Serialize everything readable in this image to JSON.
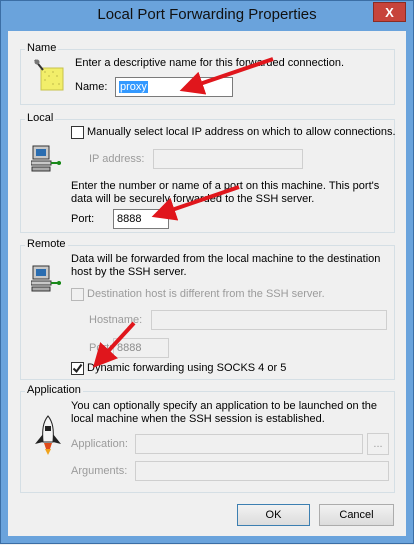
{
  "window": {
    "title": "Local Port Forwarding Properties",
    "close_glyph": "X"
  },
  "name_group": {
    "title": "Name",
    "description": "Enter a descriptive name for this forwarded connection.",
    "name_label": "Name:",
    "name_value": "proxy"
  },
  "local_group": {
    "title": "Local",
    "manual_ip_label": "Manually select local IP address on which to allow connections.",
    "manual_ip_checked": false,
    "ip_label": "IP address:",
    "ip_value": "",
    "port_desc_1": "Enter the number or name of a port on this machine.  This port's",
    "port_desc_2": "data will be securely forwarded to the SSH server.",
    "port_label": "Port:",
    "port_value": "8888"
  },
  "remote_group": {
    "title": "Remote",
    "desc_1": "Data will be forwarded from the local machine to the destination",
    "desc_2": "host by the SSH server.",
    "dest_diff_label": "Destination host is different from the SSH server.",
    "dest_diff_checked": false,
    "hostname_label": "Hostname:",
    "hostname_value": "",
    "port_label": "Port:",
    "port_value": "8888",
    "socks_label": "Dynamic forwarding using SOCKS 4 or 5",
    "socks_checked": true
  },
  "application_group": {
    "title": "Application",
    "desc_1": "You can optionally specify an application to be launched on the",
    "desc_2": "local machine when the SSH session is established.",
    "application_label": "Application:",
    "application_value": "",
    "browse_label": "...",
    "arguments_label": "Arguments:",
    "arguments_value": ""
  },
  "buttons": {
    "ok": "OK",
    "cancel": "Cancel"
  },
  "colors": {
    "title_bar": "#6aa3dc",
    "close_button": "#c7443b",
    "annotation_arrow": "#e0161c",
    "selection": "#3399ff"
  }
}
